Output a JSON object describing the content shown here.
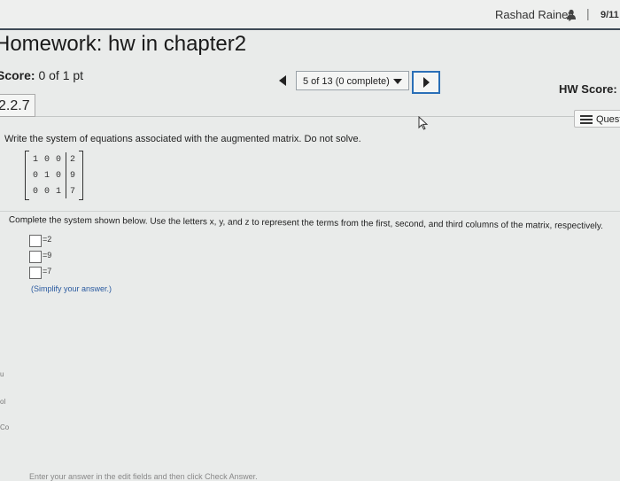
{
  "header": {
    "user_name": "Rashad Rainey",
    "separator": "|",
    "date": "9/11"
  },
  "page_title": "Homework: hw in chapter2",
  "score": {
    "label": "Score:",
    "value": "0 of 1 pt"
  },
  "nav": {
    "position_label": "5 of 13 (0 complete)"
  },
  "hw_score": {
    "label": "HW Score:",
    "value": "("
  },
  "question": {
    "number": "2.2.7",
    "instruction": "Write the system of equations associated with the augmented matrix. Do not solve.",
    "matrix": [
      [
        "1",
        "0",
        "0",
        "2"
      ],
      [
        "0",
        "1",
        "0",
        "9"
      ],
      [
        "0",
        "0",
        "1",
        "7"
      ]
    ],
    "complete_text": "Complete the system shown below. Use the letters x, y, and z to represent the terms from the first, second, and third columns of the matrix, respectively.",
    "equations": [
      {
        "rhs": "=2"
      },
      {
        "rhs": "=9"
      },
      {
        "rhs": "=7"
      }
    ],
    "simplify_note": "(Simplify your answer.)"
  },
  "question_help_label": "Quest",
  "footer_note": "Enter your answer in the edit fields and then click Check Answer.",
  "left_edge_marks": [
    "u",
    "ol",
    "Co"
  ],
  "colors": {
    "header_rule": "#3f4a56",
    "next_button_border": "#2a6fb7",
    "link_blue": "#2a5aa0"
  }
}
